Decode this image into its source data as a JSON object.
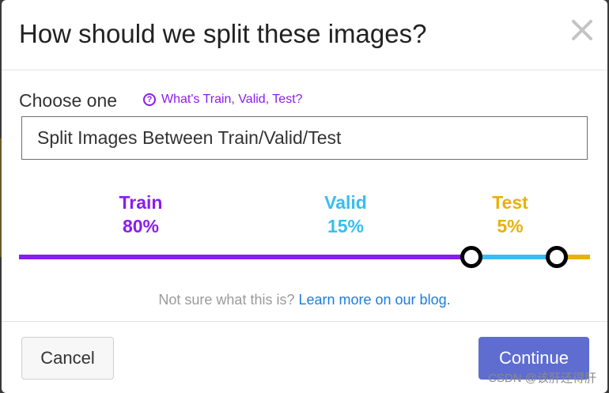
{
  "dialog": {
    "title": "How should we split these images?",
    "close_icon": "close-icon"
  },
  "choose": {
    "label": "Choose one",
    "help_icon": "question-circle-icon",
    "help_link": "What's Train, Valid, Test?",
    "selected": "Split Images Between Train/Valid/Test"
  },
  "split": {
    "train": {
      "name": "Train",
      "percent": "80%",
      "value": 80,
      "color": "#8a1cf0"
    },
    "valid": {
      "name": "Valid",
      "percent": "15%",
      "value": 15,
      "color": "#38bdf2"
    },
    "test": {
      "name": "Test",
      "percent": "5%",
      "value": 5,
      "color": "#e8b10c"
    }
  },
  "hint": {
    "text": "Not sure what this is? ",
    "link": "Learn more on our blog."
  },
  "footer": {
    "cancel_label": "Cancel",
    "continue_label": "Continue"
  },
  "watermark": "CSDN @该肝还得肝"
}
